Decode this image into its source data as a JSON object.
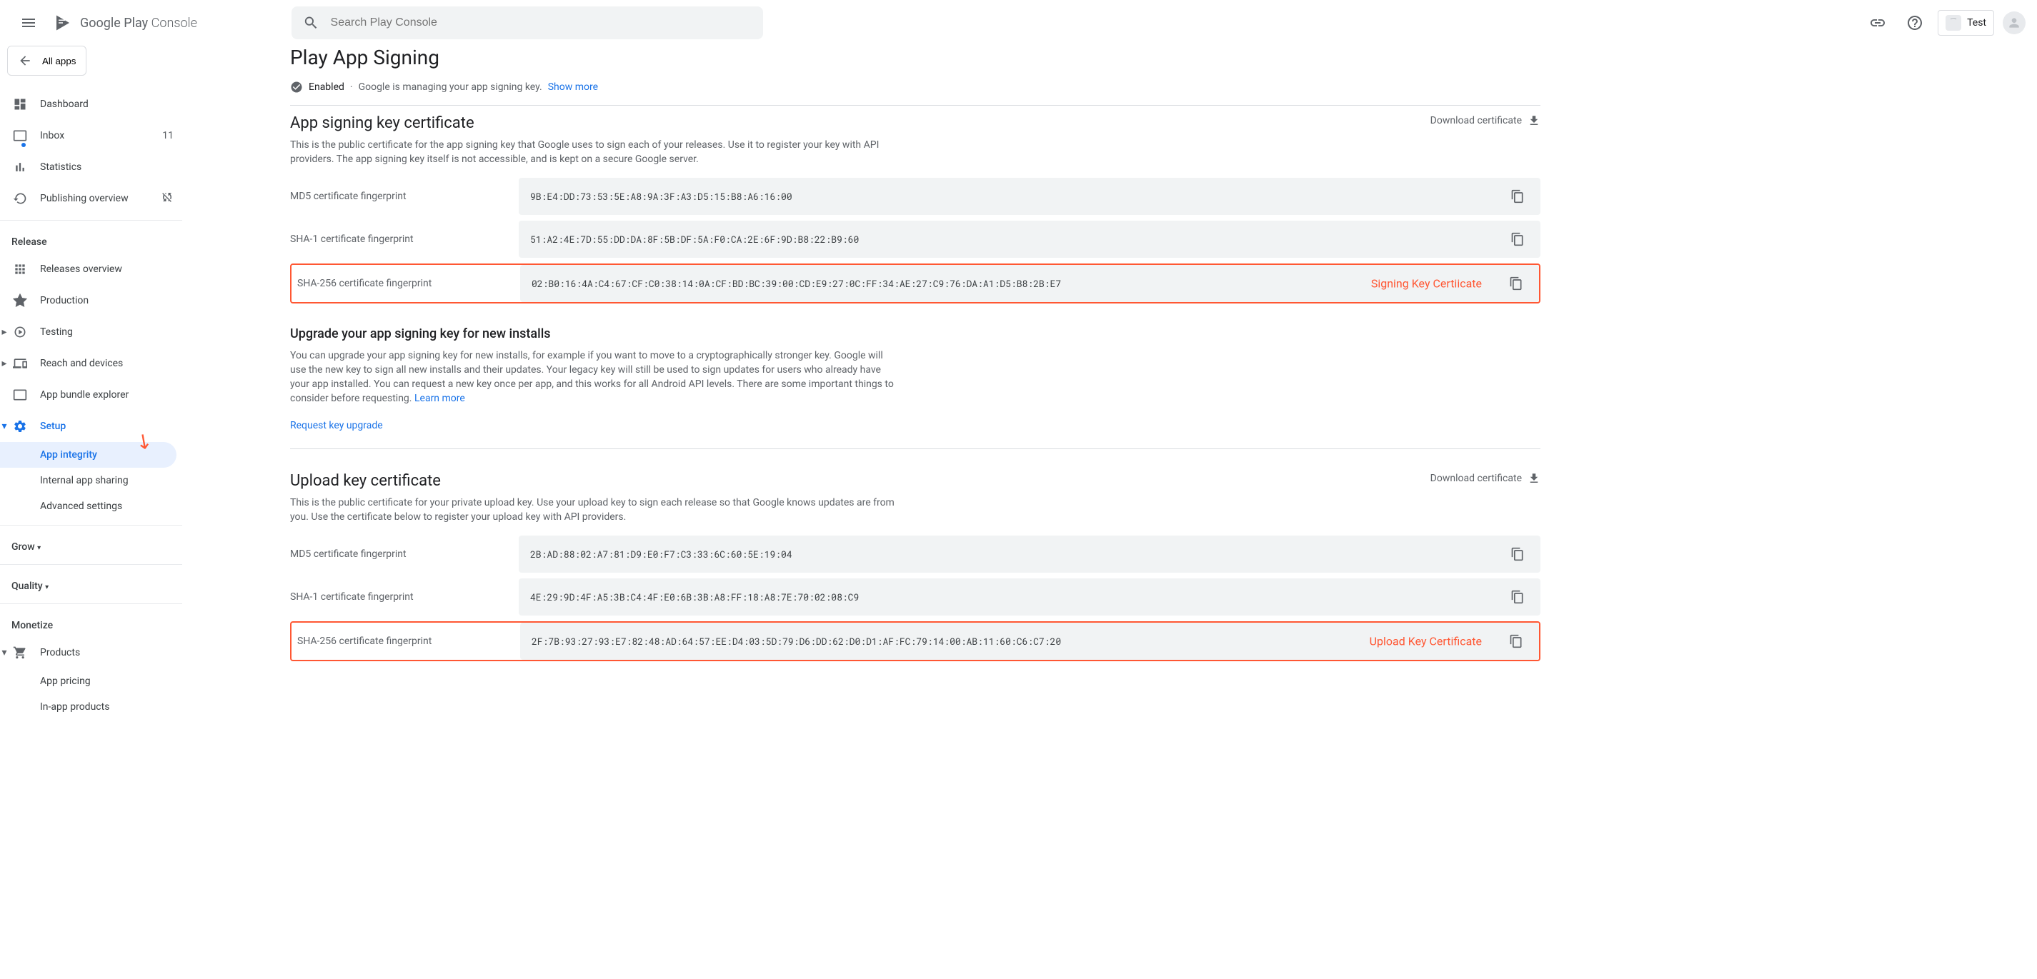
{
  "header": {
    "logoText1": "Google Play",
    "logoText2": "Console",
    "searchPlaceholder": "Search Play Console",
    "appName": "Test"
  },
  "sidebar": {
    "allApps": "All apps",
    "dashboard": "Dashboard",
    "inbox": "Inbox",
    "inboxCount": "11",
    "statistics": "Statistics",
    "publishingOverview": "Publishing overview",
    "releaseTitle": "Release",
    "releasesOverview": "Releases overview",
    "production": "Production",
    "testing": "Testing",
    "reachDevices": "Reach and devices",
    "appBundle": "App bundle explorer",
    "setup": "Setup",
    "appIntegrity": "App integrity",
    "internalSharing": "Internal app sharing",
    "advancedSettings": "Advanced settings",
    "grow": "Grow",
    "quality": "Quality",
    "monetize": "Monetize",
    "products": "Products",
    "appPricing": "App pricing",
    "inAppProducts": "In-app products"
  },
  "page": {
    "title": "Play App Signing",
    "enabled": "Enabled",
    "managingText": "Google is managing your app signing key.",
    "showMore": "Show more"
  },
  "signingCert": {
    "title": "App signing key certificate",
    "desc": "This is the public certificate for the app signing key that Google uses to sign each of your releases. Use it to register your key with API providers. The app signing key itself is not accessible, and is kept on a secure Google server.",
    "download": "Download certificate",
    "md5Label": "MD5 certificate fingerprint",
    "md5Value": "9B:E4:DD:73:53:5E:A8:9A:3F:A3:D5:15:B8:A6:16:00",
    "sha1Label": "SHA-1 certificate fingerprint",
    "sha1Value": "51:A2:4E:7D:55:DD:DA:8F:5B:DF:5A:F0:CA:2E:6F:9D:B8:22:B9:60",
    "sha256Label": "SHA-256 certificate fingerprint",
    "sha256Value": "02:B0:16:4A:C4:67:CF:C0:38:14:0A:CF:BD:BC:39:00:CD:E9:27:0C:FF:34:AE:27:C9:76:DA:A1:D5:B8:2B:E7",
    "annotation": "Signing Key Certiicate"
  },
  "upgrade": {
    "title": "Upgrade your app signing key for new installs",
    "desc": "You can upgrade your app signing key for new installs, for example if you want to move to a cryptographically stronger key. Google will use the new key to sign all new installs and their updates. Your legacy key will still be used to sign updates for users who already have your app installed. You can request a new key once per app, and this works for all Android API levels. There are some important things to consider before requesting.",
    "learnMore": "Learn more",
    "requestLink": "Request key upgrade"
  },
  "uploadCert": {
    "title": "Upload key certificate",
    "desc": "This is the public certificate for your private upload key. Use your upload key to sign each release so that Google knows updates are from you. Use the certificate below to register your upload key with API providers.",
    "download": "Download certificate",
    "md5Label": "MD5 certificate fingerprint",
    "md5Value": "2B:AD:88:02:A7:81:D9:E0:F7:C3:33:6C:60:5E:19:04",
    "sha1Label": "SHA-1 certificate fingerprint",
    "sha1Value": "4E:29:9D:4F:A5:3B:C4:4F:E0:6B:3B:A8:FF:18:A8:7E:70:02:08:C9",
    "sha256Label": "SHA-256 certificate fingerprint",
    "sha256Value": "2F:7B:93:27:93:E7:82:48:AD:64:57:EE:D4:03:5D:79:D6:DD:62:D0:D1:AF:FC:79:14:00:AB:11:60:C6:C7:20",
    "annotation": "Upload Key Certificate"
  }
}
